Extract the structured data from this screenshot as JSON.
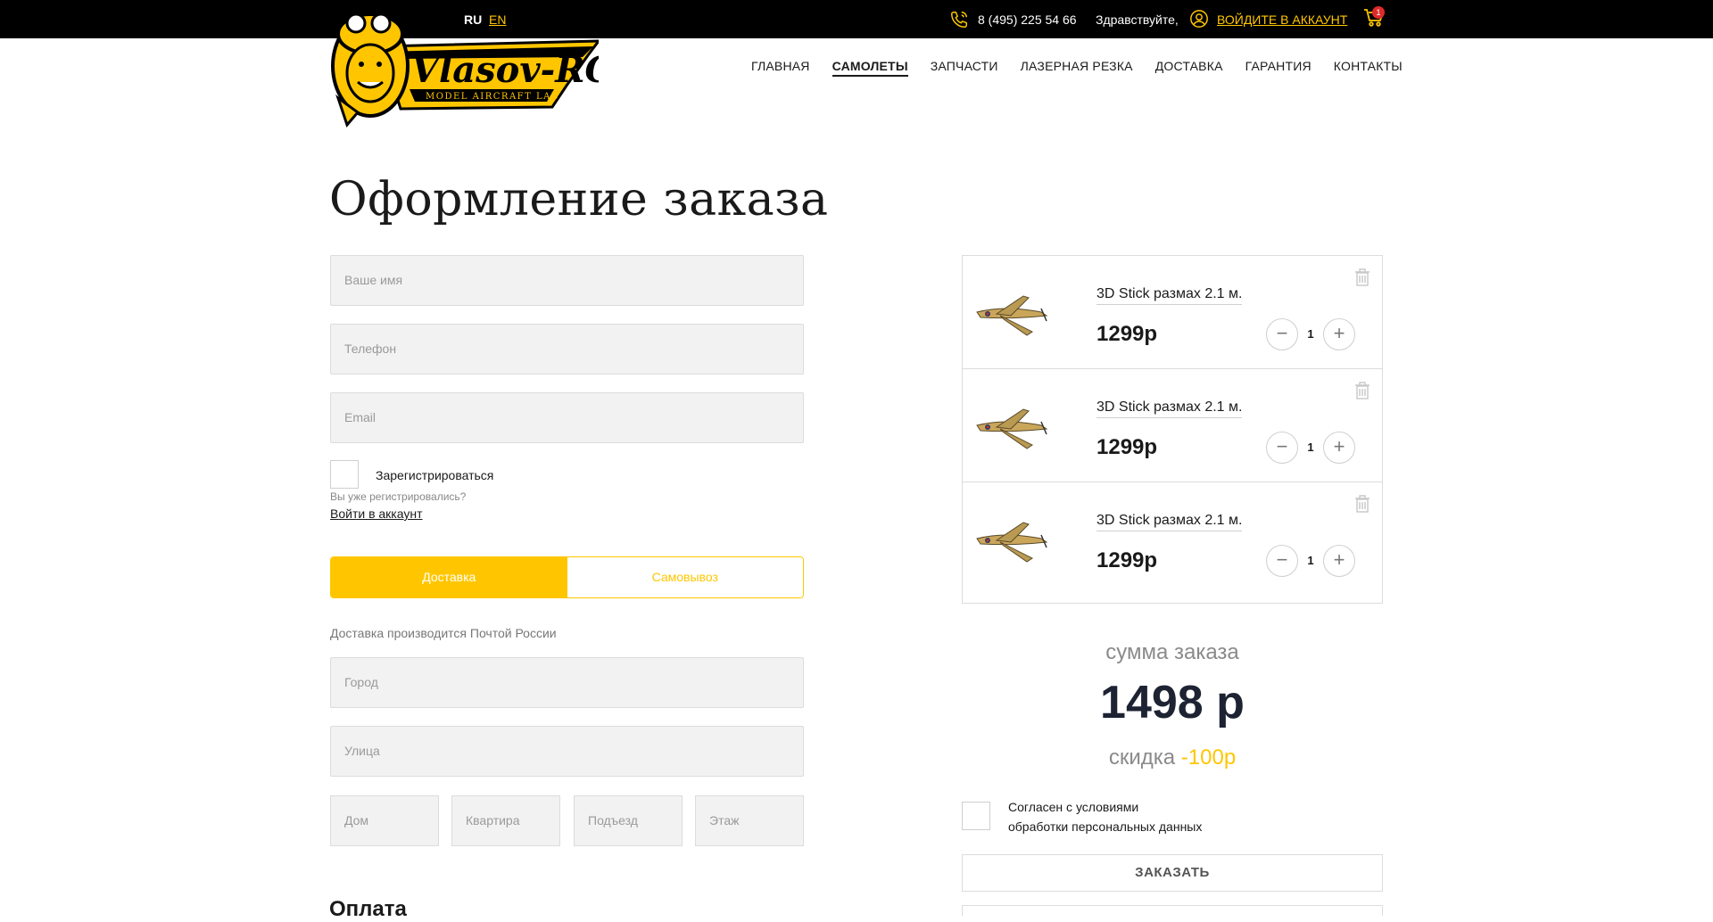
{
  "topbar": {
    "lang_ru": "RU",
    "lang_en": "EN",
    "phone": "8 (495) 225 54 66",
    "greeting": "Здравствуйте,",
    "login_link": "ВОЙДИТЕ В АККАУНТ",
    "cart_count": "1"
  },
  "logo": {
    "brand": "Vlasov-RC",
    "tagline": "MODEL AIRCRAFT LAB"
  },
  "nav": {
    "items": [
      "ГЛАВНАЯ",
      "САМОЛЕТЫ",
      "ЗАПЧАСТИ",
      "ЛАЗЕРНАЯ РЕЗКА",
      "ДОСТАВКА",
      "ГАРАНТИЯ",
      "КОНТАКТЫ"
    ],
    "active": "САМОЛЕТЫ"
  },
  "page": {
    "title": "Оформление заказа"
  },
  "form": {
    "name_placeholder": "Ваше имя",
    "phone_placeholder": "Телефон",
    "email_placeholder": "Email",
    "register_label": "Зарегистрироваться",
    "already_registered": "Вы уже регистрировались?",
    "login_account": "Войти в аккаунт",
    "delivery_option": "Доставка",
    "pickup_option": "Самовывоз",
    "delivery_note": "Доставка производится Почтой России",
    "city_placeholder": "Город",
    "street_placeholder": "Улица",
    "house_placeholder": "Дом",
    "apartment_placeholder": "Квартира",
    "entrance_placeholder": "Подъезд",
    "floor_placeholder": "Этаж",
    "payment_title": "Оплата"
  },
  "cart": {
    "items": [
      {
        "name": "3D Stick размах 2.1 м.",
        "price": "1299р",
        "qty": "1"
      },
      {
        "name": "3D Stick размах 2.1 м.",
        "price": "1299р",
        "qty": "1"
      },
      {
        "name": "3D Stick размах 2.1 м.",
        "price": "1299р",
        "qty": "1"
      }
    ],
    "sum_label": "сумма заказа",
    "sum_value": "1498 р",
    "discount_label": "скидка",
    "discount_value": "-100р",
    "agree_line1": "Согласен с условиями",
    "agree_line2": "обработки персональных данных",
    "order_button": "ЗАКАЗАТЬ"
  },
  "colors": {
    "accent": "#ffc600",
    "topbar": "#000000",
    "field_bg": "#f2f2f2"
  }
}
